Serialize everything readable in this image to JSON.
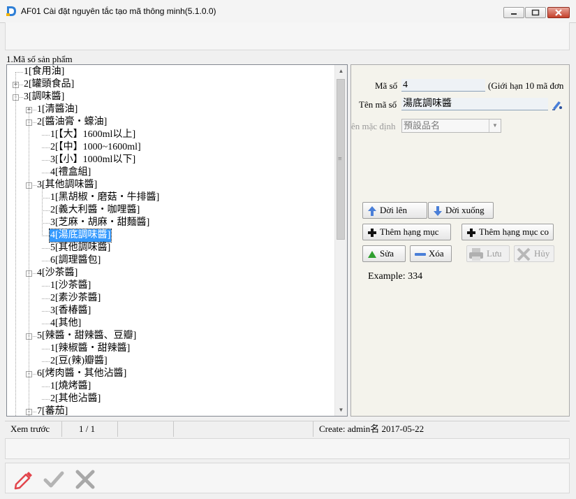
{
  "window": {
    "title": "AF01 Cài đặt nguyên tắc tạo mã thông minh(5.1.0.0)"
  },
  "section_label": "1.Mã số sản phẩm",
  "tree": {
    "items": [
      {
        "label": "1[食用油]",
        "toggle": "",
        "selected": false
      },
      {
        "label": "2[罐頭食品]",
        "toggle": "+",
        "selected": false
      },
      {
        "label": "3[調味醬]",
        "toggle": "-",
        "selected": false
      },
      {
        "label": "1[清醬油]",
        "toggle": "+",
        "selected": false
      },
      {
        "label": "2[醬油膏・蠔油]",
        "toggle": "-",
        "selected": false
      },
      {
        "label": "1[【大】1600ml以上]",
        "toggle": "",
        "selected": false
      },
      {
        "label": "2[【中】1000~1600ml]",
        "toggle": "",
        "selected": false
      },
      {
        "label": "3[【小】1000ml以下]",
        "toggle": "",
        "selected": false
      },
      {
        "label": "4[禮盒組]",
        "toggle": "",
        "selected": false
      },
      {
        "label": "3[其他調味醬]",
        "toggle": "-",
        "selected": false
      },
      {
        "label": "1[黑胡椒・磨菇・牛排醬]",
        "toggle": "",
        "selected": false
      },
      {
        "label": "2[義大利醬・咖哩醬]",
        "toggle": "",
        "selected": false
      },
      {
        "label": "3[芝麻・胡麻・甜麵醬]",
        "toggle": "",
        "selected": false
      },
      {
        "label": "4[湯底調味醬]",
        "toggle": "",
        "selected": true
      },
      {
        "label": "5[其他調味醬]",
        "toggle": "",
        "selected": false
      },
      {
        "label": "6[調理醬包]",
        "toggle": "",
        "selected": false
      },
      {
        "label": "4[沙茶醬]",
        "toggle": "-",
        "selected": false
      },
      {
        "label": "1[沙茶醬]",
        "toggle": "",
        "selected": false
      },
      {
        "label": "2[素沙茶醬]",
        "toggle": "",
        "selected": false
      },
      {
        "label": "3[香椿醬]",
        "toggle": "",
        "selected": false
      },
      {
        "label": "4[其他]",
        "toggle": "",
        "selected": false
      },
      {
        "label": "5[辣醬・甜辣醬、豆瓣]",
        "toggle": "-",
        "selected": false
      },
      {
        "label": "1[辣椒醬・甜辣醬]",
        "toggle": "",
        "selected": false
      },
      {
        "label": "2[豆(辣)瓣醬]",
        "toggle": "",
        "selected": false
      },
      {
        "label": "6[烤肉醬・其他沾醬]",
        "toggle": "-",
        "selected": false
      },
      {
        "label": "1[燒烤醬]",
        "toggle": "",
        "selected": false
      },
      {
        "label": "2[其他沾醬]",
        "toggle": "",
        "selected": false
      },
      {
        "label": "7[蕃茄]",
        "toggle": "-",
        "selected": false
      }
    ]
  },
  "form": {
    "code_label": "Mã số",
    "code_value": "4",
    "limit_note": "(Giới hạn 10 mã đơn",
    "name_label": "Tên mã số",
    "name_value": "湯底調味醬",
    "default_name_label": "Tên mặc định",
    "default_name_value": "預設品名"
  },
  "buttons": {
    "move_up": "Dời lên",
    "move_down": "Dời xuống",
    "add_item": "Thêm hạng mục",
    "add_child": "Thêm hạng mục co",
    "edit": "Sửa",
    "delete": "Xóa",
    "save": "Lưu",
    "cancel": "Hủy"
  },
  "example": "Example: 334",
  "status": {
    "preview": "Xem trước",
    "page": "1 / 1",
    "create": "Create: admin名 2017-05-22"
  },
  "colors": {
    "selection": "#3399ff",
    "arrow_blue": "#4a7fd8",
    "green": "#2e9e2e",
    "pencil_red": "#e2454c"
  },
  "icons": [
    "app-logo-icon",
    "minimize-icon",
    "maximize-icon",
    "close-icon",
    "arrow-up-icon",
    "arrow-down-icon",
    "plus-icon",
    "triangle-up-icon",
    "minus-icon",
    "printer-icon",
    "x-icon",
    "pencil-icon",
    "check-icon",
    "edit-pen-icon"
  ]
}
